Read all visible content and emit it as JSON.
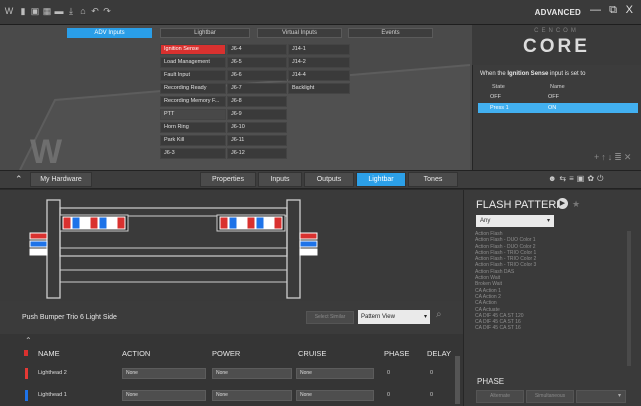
{
  "titlebar": {
    "mode": "ADVANCED",
    "minimize": "—",
    "maximize": "⧉",
    "close": "X"
  },
  "top_tabs": [
    "ADV Inputs",
    "Lightbar",
    "Virtual Inputs",
    "Events"
  ],
  "inputs_col1": [
    "Ignition Sense",
    "Load Management",
    "Fault Input",
    "Recording Ready",
    "Recording Memory F...",
    "PTT",
    "Horn Ring",
    "Park Kill",
    "J6-3"
  ],
  "inputs_col2": [
    "J6-4",
    "J6-5",
    "J6-6",
    "J6-7",
    "J6-8",
    "J6-9",
    "J6-10",
    "J6-11",
    "J6-12"
  ],
  "inputs_col3": [
    "J14-1",
    "J14-2",
    "J14-4",
    "Backlight"
  ],
  "core_panel": {
    "brand_small": "CENCOM",
    "brand_big": "CORE",
    "desc_prefix": "When the",
    "desc_input": "Ignition Sense",
    "desc_suffix": "input is set to",
    "col_state": "State",
    "col_name": "Name",
    "rows": [
      {
        "state": "OFF",
        "name": "OFF"
      },
      {
        "state": "Press 1",
        "name": "ON"
      }
    ]
  },
  "toolbar": {
    "hardware": "My Hardware",
    "tabs": [
      "Properties",
      "Inputs",
      "Outputs",
      "Lightbar",
      "Tones"
    ],
    "active_tab": "Lightbar"
  },
  "canvas": {
    "device_name": "Push Bumper Trio 6 Light Side",
    "select_similar": "Select Similar",
    "view_mode": "Pattern View"
  },
  "table": {
    "headers": [
      "NAME",
      "ACTION",
      "POWER",
      "CRUISE",
      "PHASE",
      "DELAY"
    ],
    "rows": [
      {
        "name": "Lighthead 2",
        "action": "None",
        "power": "None",
        "cruise": "None",
        "phase": "0",
        "delay": "0",
        "color": "#e53935"
      },
      {
        "name": "Lighthead 1",
        "action": "None",
        "power": "None",
        "cruise": "None",
        "phase": "0",
        "delay": "0",
        "color": "#1e73e8"
      }
    ]
  },
  "flash": {
    "title": "FLASH PATTERN",
    "filter": "Any",
    "patterns": [
      "Action Flash",
      "Action Flash - DUO Color 1",
      "Action Flash - DUO Color 2",
      "Action Flash - TRIO Color 1",
      "Action Flash - TRIO Color 2",
      "Action Flash - TRIO Color 3",
      "Action Flash DAS",
      "Action Wait",
      "Broken Wait",
      "CA Action 1",
      "CA Action 2",
      "CA Action",
      "CA Actuate",
      "CA DIF 45 CA ST 120",
      "CA DIF 45 CA ST 16",
      "CA DIF 45 CA ST 16"
    ],
    "phase_label": "PHASE",
    "phase_buttons": [
      "Alternate",
      "Simultaneous"
    ]
  },
  "colors": {
    "accent": "#2ca0e8",
    "red": "#d9312f",
    "blue": "#1e73e8"
  }
}
